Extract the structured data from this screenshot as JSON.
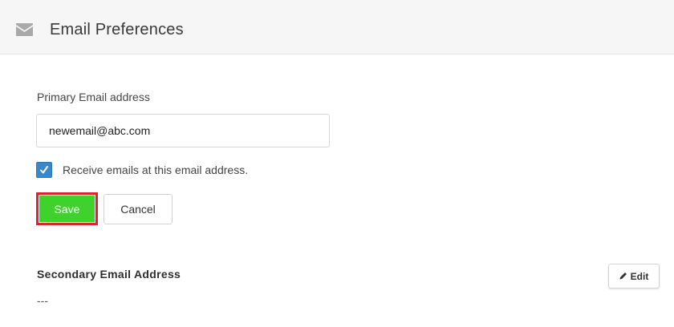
{
  "header": {
    "icon": "mail-icon",
    "title": "Email Preferences"
  },
  "primary": {
    "label": "Primary Email address",
    "value": "newemail@abc.com",
    "checkbox_checked": true,
    "checkbox_label": "Receive emails at this email address."
  },
  "actions": {
    "save_label": "Save",
    "cancel_label": "Cancel"
  },
  "secondary": {
    "title": "Secondary Email Address",
    "edit_icon": "pencil-icon",
    "edit_label": "Edit",
    "value": "---"
  },
  "colors": {
    "save": "#3fd22c",
    "highlight": "#e0222e",
    "checkbox": "#3a88cc",
    "header_bg": "#f6f6f6"
  }
}
